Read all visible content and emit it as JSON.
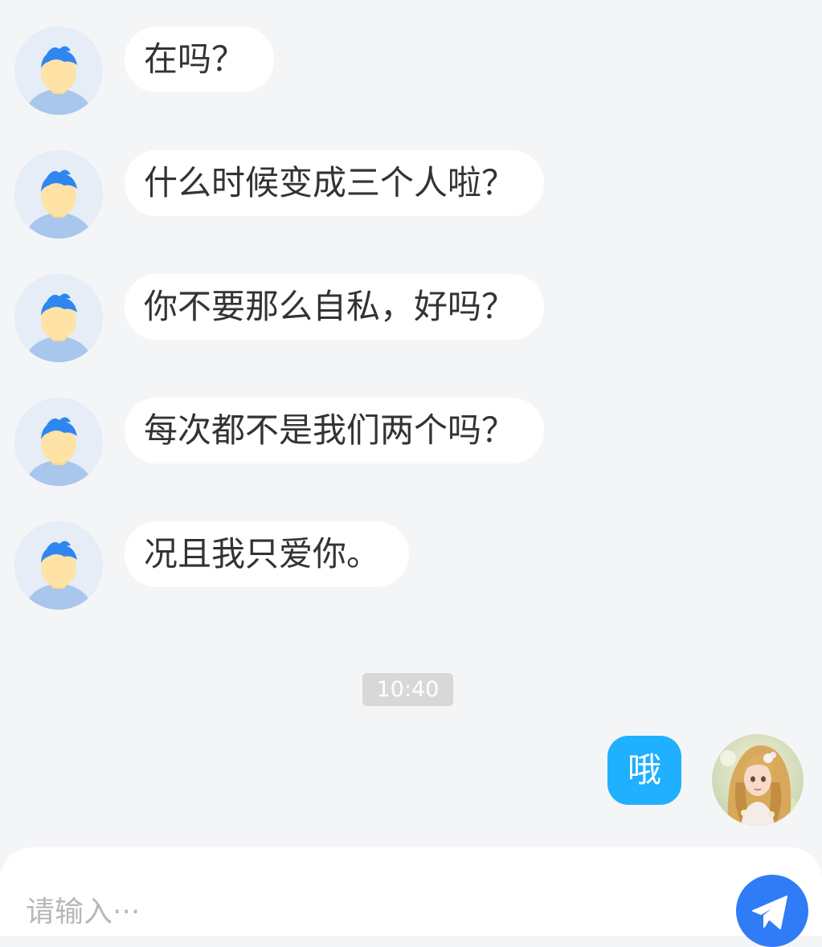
{
  "incoming_messages": [
    {
      "text": "在吗？"
    },
    {
      "text": "什么时候变成三个人啦？"
    },
    {
      "text": "你不要那么自私，好吗？"
    },
    {
      "text": "每次都不是我们两个吗？"
    },
    {
      "text": "况且我只爱你。"
    }
  ],
  "timestamp": "10:40",
  "outgoing_message": {
    "text": "哦"
  },
  "composer": {
    "placeholder": "请输入···",
    "value": ""
  },
  "colors": {
    "background": "#f4f5f7",
    "incoming_bubble": "#ffffff",
    "outgoing_bubble": "#1fb0ff",
    "send_button": "#2f7cf6"
  },
  "icons": {
    "default_avatar": "default-user-avatar-icon",
    "send": "paper-plane-icon"
  }
}
